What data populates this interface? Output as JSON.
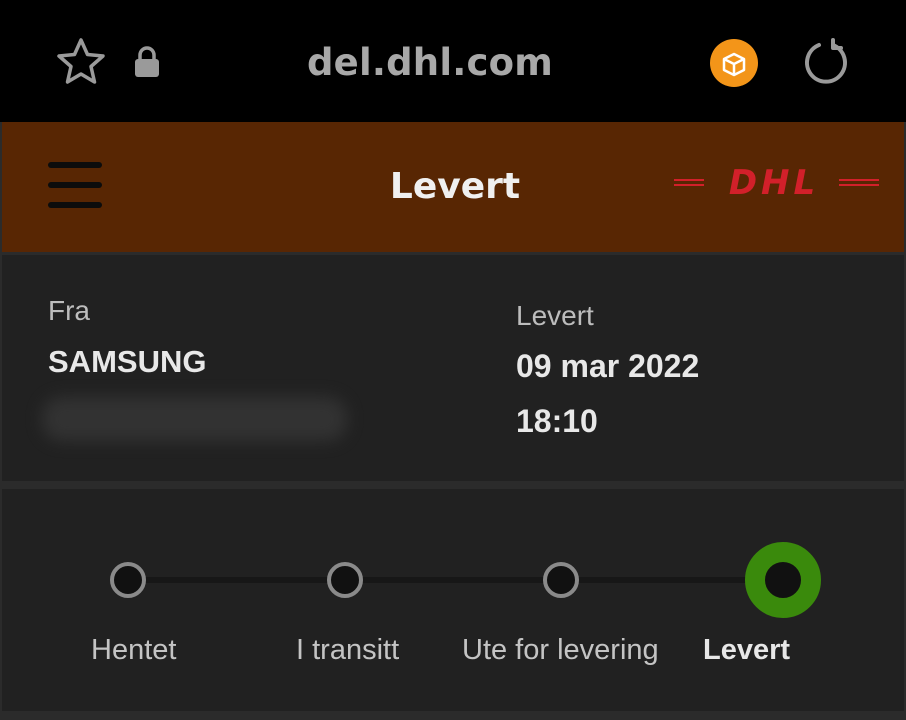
{
  "browser": {
    "url": "del.dhl.com"
  },
  "header": {
    "title": "Levert",
    "logo_text": "DHL"
  },
  "shipment": {
    "from_label": "Fra",
    "sender": "SAMSUNG",
    "status_label": "Levert",
    "date": "09 mar 2022",
    "time": "18:10"
  },
  "progress": {
    "steps": [
      {
        "label": "Hentet",
        "active": false
      },
      {
        "label": "I transitt",
        "active": false
      },
      {
        "label": "Ute for levering",
        "active": false
      },
      {
        "label": "Levert",
        "active": true
      }
    ]
  },
  "colors": {
    "header_bg": "#582603",
    "dhl_red": "#d2202a",
    "active_green": "#3a8a0c",
    "extension_orange": "#f39519"
  },
  "icons": [
    "star-icon",
    "lock-icon",
    "extension-icon",
    "reload-icon",
    "hamburger-icon"
  ]
}
